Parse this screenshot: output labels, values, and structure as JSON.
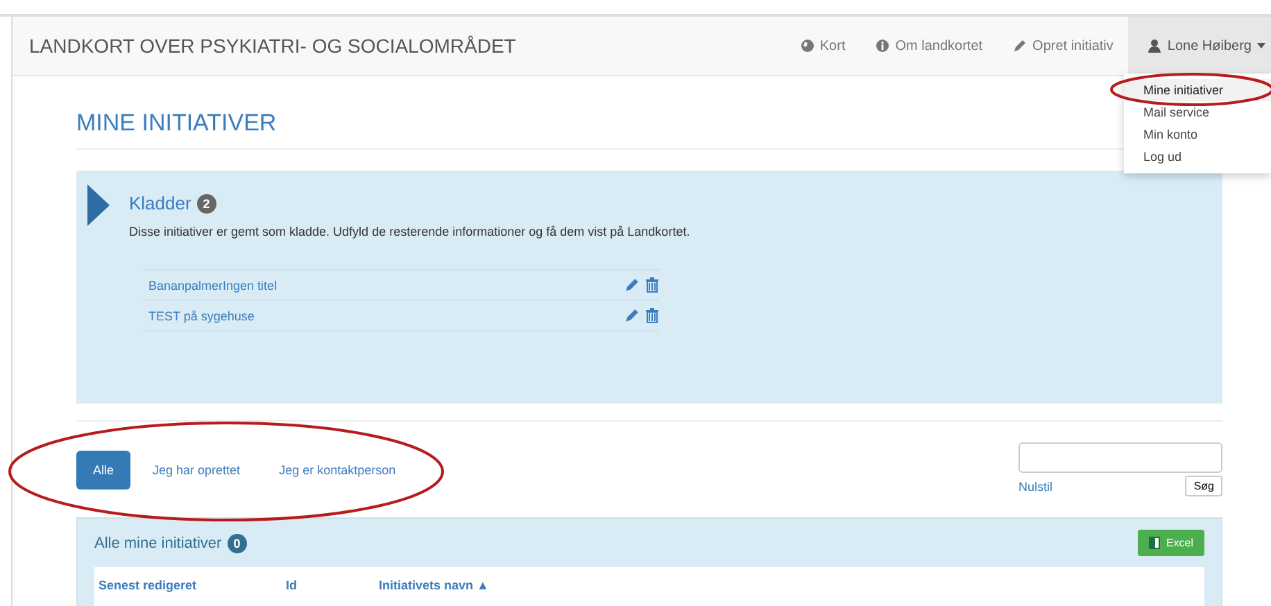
{
  "navbar": {
    "brand": "LANDKORT OVER PSYKIATRI- OG SOCIALOMRÅDET",
    "items": [
      {
        "label": "Kort",
        "kind": "globe"
      },
      {
        "label": "Om landkortet",
        "kind": "info"
      },
      {
        "label": "Opret initiativ",
        "kind": "pencil"
      }
    ],
    "user": {
      "label": "Lone Høiberg",
      "expanded": true,
      "menu": [
        {
          "label": "Mine initiativer",
          "selected": true
        },
        {
          "label": "Mail service",
          "selected": false
        },
        {
          "label": "Min konto",
          "selected": false
        },
        {
          "label": "Log ud",
          "selected": false
        }
      ]
    }
  },
  "page_title": "MINE INITIATIVER",
  "drafts": {
    "title": "Kladder",
    "count": "2",
    "description": "Disse initiativer er gemt som kladde. Udfyld de resterende informationer og få dem vist på Landkortet.",
    "items": [
      {
        "title": "BananpalmerIngen titel"
      },
      {
        "title": "TEST på sygehuse"
      }
    ]
  },
  "filters": [
    {
      "label": "Alle",
      "selected": true
    },
    {
      "label": "Jeg har oprettet",
      "selected": false
    },
    {
      "label": "Jeg er kontaktperson",
      "selected": false
    }
  ],
  "search": {
    "reset": "Nulstil",
    "button": "Søg"
  },
  "list": {
    "title": "Alle mine initiativer",
    "count": "0",
    "export": "Excel",
    "columns": [
      "Senest redigeret",
      "Id",
      "Initiativets navn ▲"
    ]
  }
}
